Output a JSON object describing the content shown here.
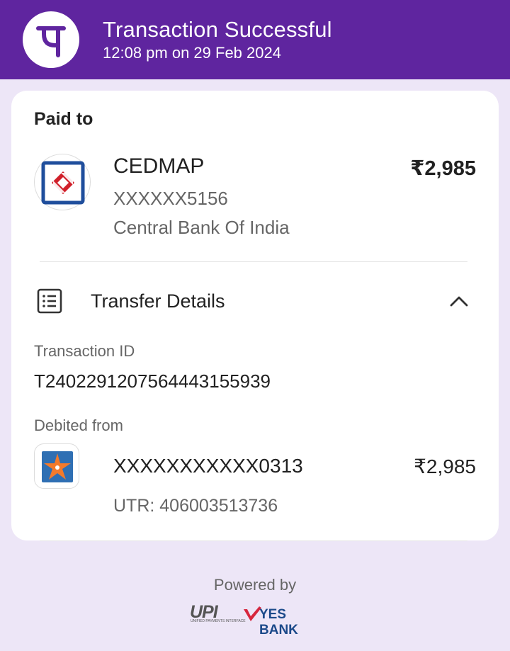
{
  "header": {
    "title": "Transaction Successful",
    "datetime": "12:08 pm on 29 Feb 2024",
    "brand_color": "#5f259f",
    "brand_icon": "phonepe-logo-icon"
  },
  "payment": {
    "paid_to_label": "Paid to",
    "payee_name": "CEDMAP",
    "payee_account": "XXXXXX5156",
    "payee_bank": "Central Bank Of India",
    "payee_bank_icon": "central-bank-logo-icon",
    "amount": "₹2,985"
  },
  "transfer_details": {
    "section_label": "Transfer Details",
    "section_icon": "list-icon",
    "expanded": true,
    "transaction_id_label": "Transaction ID",
    "transaction_id": "T2402291207564443155939",
    "debited_from_label": "Debited from",
    "debit_account": "XXXXXXXXXXX0313",
    "debit_bank_icon": "bank-of-india-logo-icon",
    "debit_amount": "₹2,985",
    "utr": "UTR: 406003513736"
  },
  "footer": {
    "powered_by": "Powered by",
    "upi_logo_text": "UPI",
    "upi_tagline": "UNIFIED PAYMENTS INTERFACE",
    "partner_bank": "YES BANK"
  },
  "colors": {
    "background": "#ede6f7",
    "card": "#ffffff",
    "secondary_text": "#666666"
  }
}
